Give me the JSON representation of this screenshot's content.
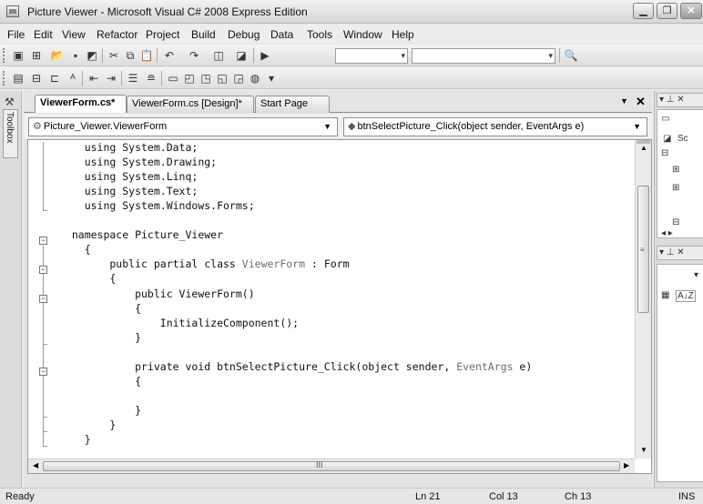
{
  "window": {
    "title": "Picture Viewer - Microsoft Visual C# 2008 Express Edition",
    "controls": [
      "minimize",
      "maximize",
      "close"
    ]
  },
  "menu": {
    "items": [
      "File",
      "Edit",
      "View",
      "Refactor",
      "Project",
      "Build",
      "Debug",
      "Data",
      "Tools",
      "Window",
      "Help"
    ]
  },
  "toolbar1": {
    "icons": [
      "new-project-icon",
      "add-item-icon",
      "open-file-icon",
      "save-icon",
      "save-all-icon",
      "cut-icon",
      "copy-icon",
      "paste-icon",
      "undo-icon",
      "redo-icon",
      "navigate-backward-icon",
      "navigate-forward-icon",
      "start-debugging-icon",
      "find-in-files-icon"
    ],
    "solution_config": "",
    "solution_platform": ""
  },
  "toolbar2": {
    "icons": [
      "outlining-icon",
      "member-list-icon",
      "complete-word-icon",
      "decrease-indent-icon",
      "increase-indent-icon",
      "comment-icon",
      "uncomment-icon",
      "bookmark-icon",
      "prev-bookmark-icon",
      "next-bookmark-icon"
    ]
  },
  "toolbox": {
    "label": "Toolbox"
  },
  "document_tabs": [
    {
      "label": "ViewerForm.cs*",
      "active": true
    },
    {
      "label": "ViewerForm.cs [Design]*",
      "active": false
    },
    {
      "label": "Start Page",
      "active": false
    }
  ],
  "navbar": {
    "class_combo": "Picture_Viewer.ViewerForm",
    "member_combo": "btnSelectPicture_Click(object sender, EventArgs e)"
  },
  "code": {
    "lines": [
      {
        "pre": "    using System.Data;",
        "ty": "",
        "post": ""
      },
      {
        "pre": "    using System.Drawing;",
        "ty": "",
        "post": ""
      },
      {
        "pre": "    using System.Linq;",
        "ty": "",
        "post": ""
      },
      {
        "pre": "    using System.Text;",
        "ty": "",
        "post": ""
      },
      {
        "pre": "    using System.Windows.Forms;",
        "ty": "",
        "post": ""
      },
      {
        "pre": "",
        "ty": "",
        "post": ""
      },
      {
        "pre": "  namespace Picture_Viewer",
        "ty": "",
        "post": ""
      },
      {
        "pre": "    {",
        "ty": "",
        "post": ""
      },
      {
        "pre": "        public partial class ",
        "ty": "ViewerForm",
        "post": " : Form"
      },
      {
        "pre": "        {",
        "ty": "",
        "post": ""
      },
      {
        "pre": "            public ViewerForm()",
        "ty": "",
        "post": ""
      },
      {
        "pre": "            {",
        "ty": "",
        "post": ""
      },
      {
        "pre": "                InitializeComponent();",
        "ty": "",
        "post": ""
      },
      {
        "pre": "            }",
        "ty": "",
        "post": ""
      },
      {
        "pre": "",
        "ty": "",
        "post": ""
      },
      {
        "pre": "            private void btnSelectPicture_Click(object sender, ",
        "ty": "EventArgs",
        "post": " e)"
      },
      {
        "pre": "            {",
        "ty": "",
        "post": ""
      },
      {
        "pre": "",
        "ty": "",
        "post": ""
      },
      {
        "pre": "            }",
        "ty": "",
        "post": ""
      },
      {
        "pre": "        }",
        "ty": "",
        "post": ""
      },
      {
        "pre": "    }",
        "ty": "",
        "post": ""
      }
    ]
  },
  "right_dock": {
    "solution_explorer_label": "Sc",
    "properties_sort_label": "A↓Z"
  },
  "status": {
    "ready": "Ready",
    "line": "Ln 21",
    "col": "Col 13",
    "ch": "Ch 13",
    "mode": "INS"
  }
}
